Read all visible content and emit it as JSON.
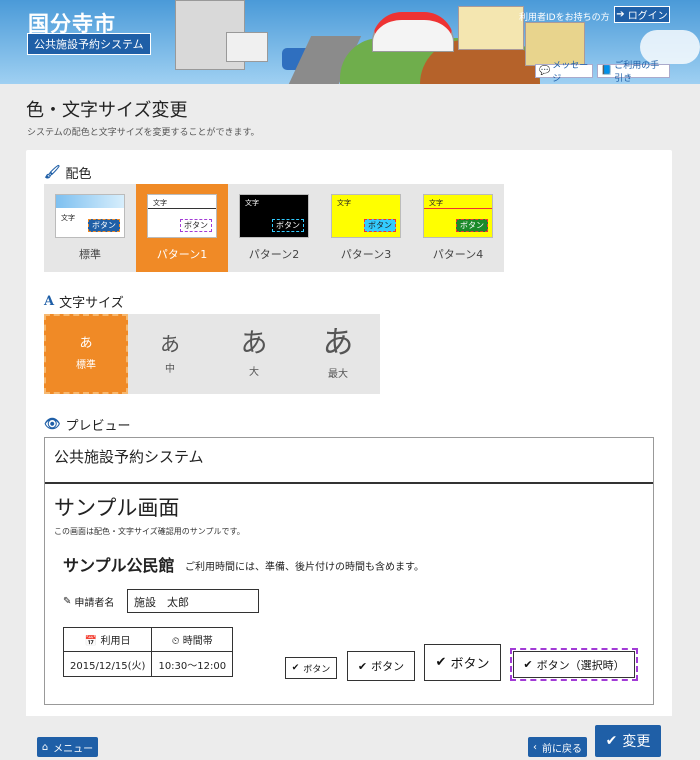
{
  "header": {
    "city_name": "国分寺市",
    "system_name": "公共施設予約システム",
    "id_text": "利用者IDをお持ちの方",
    "login_label": "ログイン",
    "message_label": "メッセージ",
    "guide_label": "ご利用の手引き"
  },
  "page": {
    "title": "色・文字サイズ変更",
    "description": "システムの配色と文字サイズを変更することができます。"
  },
  "color_section": {
    "label": "配色",
    "thumb_text": "文字",
    "thumb_button": "ボタン",
    "options": [
      {
        "label": "標準",
        "bg": "#ffffff",
        "fg": "#222222",
        "selected": false
      },
      {
        "label": "パターン1",
        "bg": "#ffffff",
        "fg": "#222222",
        "selected": true
      },
      {
        "label": "パターン2",
        "bg": "#000000",
        "fg": "#ffffff",
        "selected": false
      },
      {
        "label": "パターン3",
        "bg": "#ffff00",
        "fg": "#222222",
        "selected": false
      },
      {
        "label": "パターン4",
        "bg": "#ffff00",
        "fg": "#222222",
        "selected": false
      }
    ]
  },
  "size_section": {
    "label": "文字サイズ",
    "options": [
      {
        "glyph": "あ",
        "label": "標準",
        "selected": true
      },
      {
        "glyph": "あ",
        "label": "中",
        "selected": false
      },
      {
        "glyph": "あ",
        "label": "大",
        "selected": false
      },
      {
        "glyph": "あ",
        "label": "最大",
        "selected": false
      }
    ]
  },
  "preview_section": {
    "label": "プレビュー",
    "system_title": "公共施設予約システム",
    "screen_title": "サンプル画面",
    "description": "この画面は配色・文字サイズ確認用のサンプルです。",
    "place_name": "サンプル公民館",
    "note": "ご利用時間には、準備、後片付けの時間も含めます。",
    "applicant_label": "申請者名",
    "applicant_value": "施設　太郎",
    "table": {
      "headers": [
        "利用日",
        "時間帯"
      ],
      "row": [
        "2015/12/15(火)",
        "10:30〜12:00"
      ]
    },
    "buttons": [
      "ボタン",
      "ボタン",
      "ボタン",
      "ボタン（選択時）"
    ]
  },
  "footer": {
    "menu_label": "メニュー",
    "back_label": "前に戻る",
    "change_label": "変更"
  },
  "colors": {
    "accent": "#f08a26",
    "primary": "#1f5fa7"
  }
}
